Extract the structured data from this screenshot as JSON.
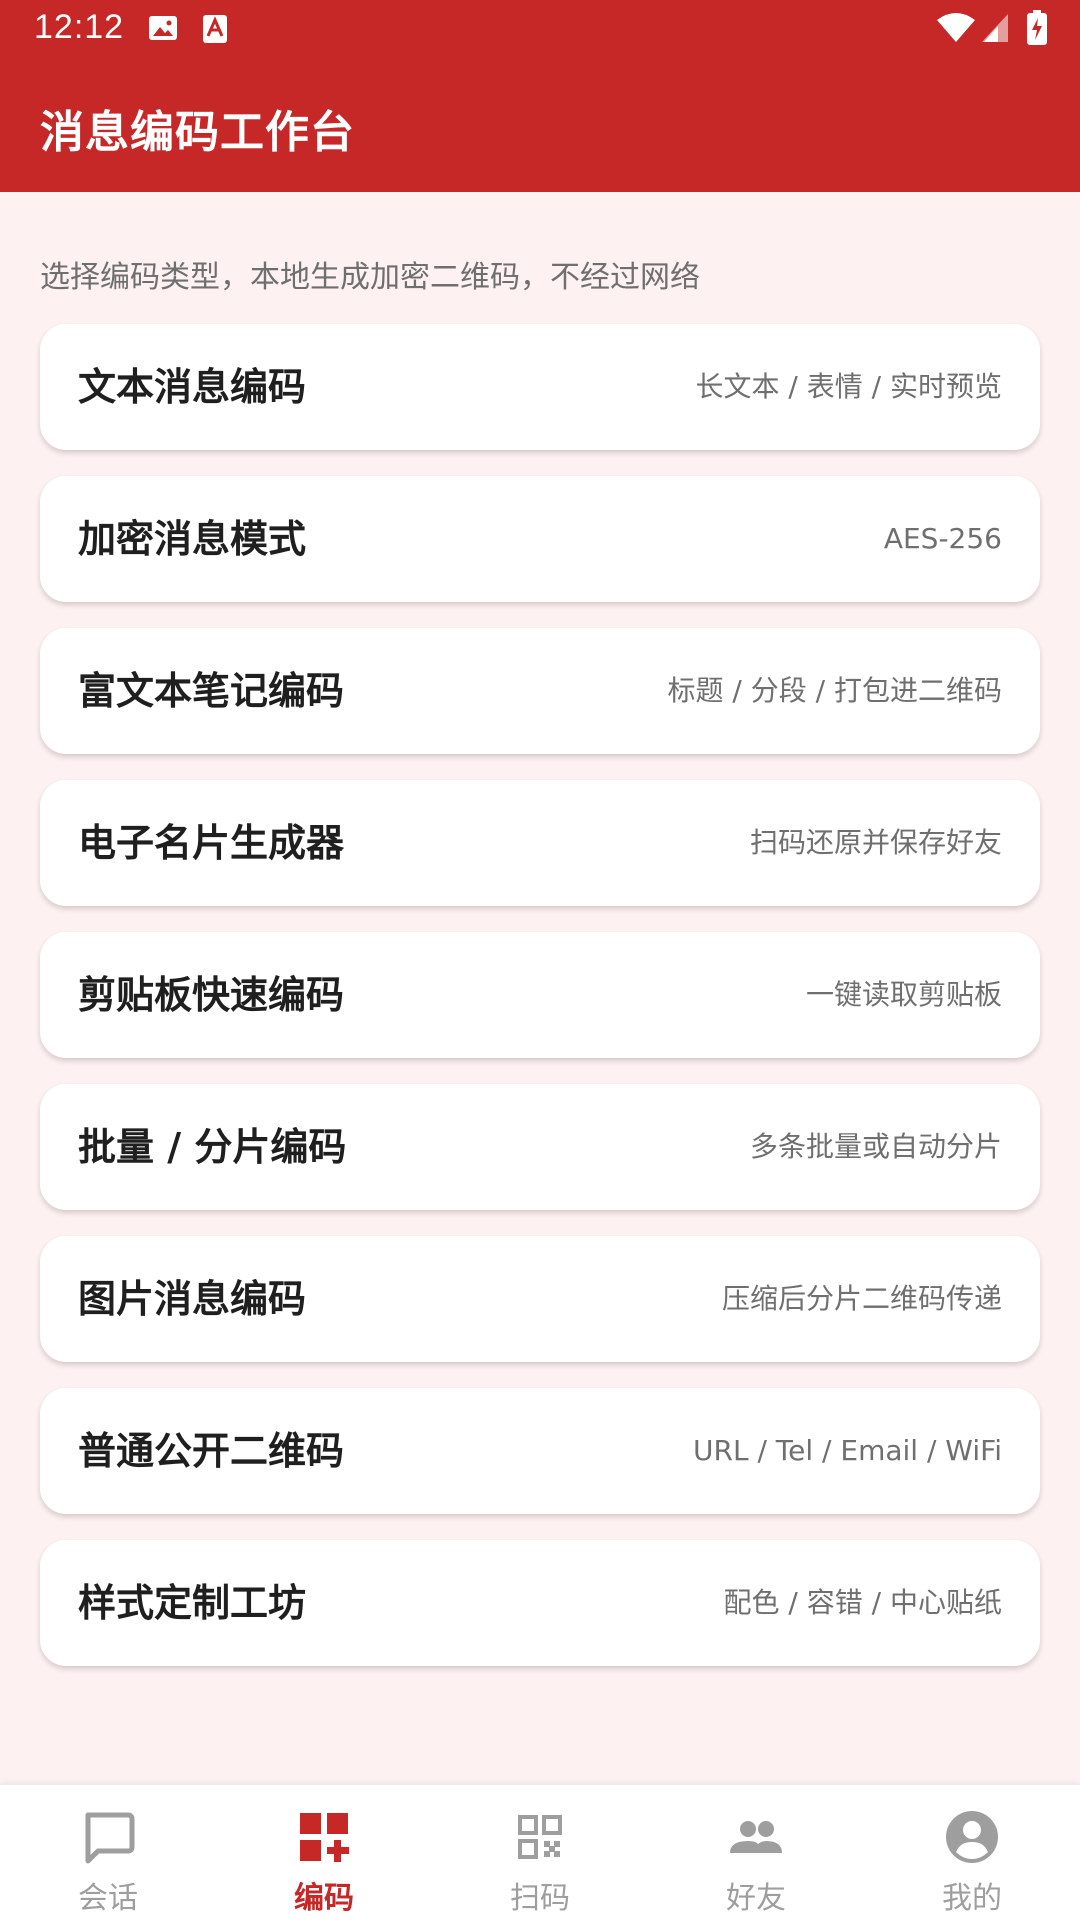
{
  "status_bar": {
    "time": "12:12"
  },
  "app_bar": {
    "title": "消息编码工作台"
  },
  "main": {
    "subtitle": "选择编码类型，本地生成加密二维码，不经过网络",
    "cards": [
      {
        "title": "文本消息编码",
        "subtitle": "长文本 / 表情 / 实时预览"
      },
      {
        "title": "加密消息模式",
        "subtitle": "AES-256"
      },
      {
        "title": "富文本笔记编码",
        "subtitle": "标题 / 分段 / 打包进二维码"
      },
      {
        "title": "电子名片生成器",
        "subtitle": "扫码还原并保存好友"
      },
      {
        "title": "剪贴板快速编码",
        "subtitle": "一键读取剪贴板"
      },
      {
        "title": "批量 / 分片编码",
        "subtitle": "多条批量或自动分片"
      },
      {
        "title": "图片消息编码",
        "subtitle": "压缩后分片二维码传递"
      },
      {
        "title": "普通公开二维码",
        "subtitle": "URL / Tel / Email / WiFi"
      },
      {
        "title": "样式定制工坊",
        "subtitle": "配色 / 容错 / 中心贴纸"
      }
    ]
  },
  "bottom_nav": {
    "items": [
      {
        "label": "会话",
        "icon": "chat-icon",
        "active": false
      },
      {
        "label": "编码",
        "icon": "encode-icon",
        "active": true
      },
      {
        "label": "扫码",
        "icon": "qr-scan-icon",
        "active": false
      },
      {
        "label": "好友",
        "icon": "friends-icon",
        "active": false
      },
      {
        "label": "我的",
        "icon": "profile-icon",
        "active": false
      }
    ]
  },
  "colors": {
    "primary": "#c62828",
    "background": "#fdf1f1",
    "inactive": "#9e9e9e"
  }
}
